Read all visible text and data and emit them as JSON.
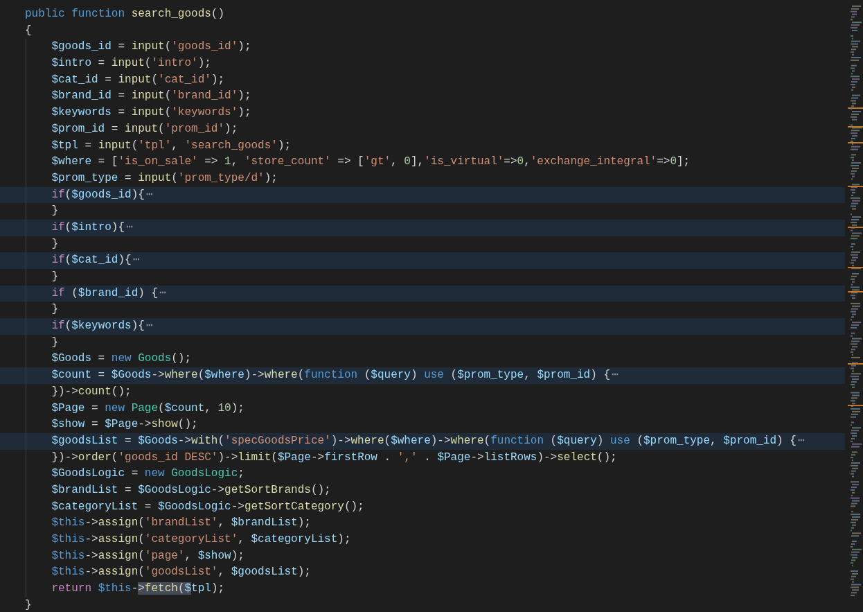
{
  "editor": {
    "lines": [
      {
        "folded": false,
        "tokens": [
          {
            "kind": "kw",
            "text": "public "
          },
          {
            "kind": "kw",
            "text": "function "
          },
          {
            "kind": "fn",
            "text": "search_goods"
          },
          {
            "kind": "p",
            "text": "()"
          }
        ]
      },
      {
        "folded": false,
        "tokens": [
          {
            "kind": "p",
            "text": "{"
          }
        ]
      },
      {
        "folded": false,
        "tokens": [
          {
            "kind": "var",
            "text": "    $goods_id"
          },
          {
            "kind": "p",
            "text": " = "
          },
          {
            "kind": "fn",
            "text": "input"
          },
          {
            "kind": "p",
            "text": "("
          },
          {
            "kind": "str",
            "text": "'goods_id'"
          },
          {
            "kind": "p",
            "text": ");"
          }
        ]
      },
      {
        "folded": false,
        "tokens": [
          {
            "kind": "var",
            "text": "    $intro"
          },
          {
            "kind": "p",
            "text": " = "
          },
          {
            "kind": "fn",
            "text": "input"
          },
          {
            "kind": "p",
            "text": "("
          },
          {
            "kind": "str",
            "text": "'intro'"
          },
          {
            "kind": "p",
            "text": ");"
          }
        ]
      },
      {
        "folded": false,
        "tokens": [
          {
            "kind": "var",
            "text": "    $cat_id"
          },
          {
            "kind": "p",
            "text": " = "
          },
          {
            "kind": "fn",
            "text": "input"
          },
          {
            "kind": "p",
            "text": "("
          },
          {
            "kind": "str",
            "text": "'cat_id'"
          },
          {
            "kind": "p",
            "text": ");"
          }
        ]
      },
      {
        "folded": false,
        "tokens": [
          {
            "kind": "var",
            "text": "    $brand_id"
          },
          {
            "kind": "p",
            "text": " = "
          },
          {
            "kind": "fn",
            "text": "input"
          },
          {
            "kind": "p",
            "text": "("
          },
          {
            "kind": "str",
            "text": "'brand_id'"
          },
          {
            "kind": "p",
            "text": ");"
          }
        ]
      },
      {
        "folded": false,
        "tokens": [
          {
            "kind": "var",
            "text": "    $keywords"
          },
          {
            "kind": "p",
            "text": " = "
          },
          {
            "kind": "fn",
            "text": "input"
          },
          {
            "kind": "p",
            "text": "("
          },
          {
            "kind": "str",
            "text": "'keywords'"
          },
          {
            "kind": "p",
            "text": ");"
          }
        ]
      },
      {
        "folded": false,
        "tokens": [
          {
            "kind": "var",
            "text": "    $prom_id"
          },
          {
            "kind": "p",
            "text": " = "
          },
          {
            "kind": "fn",
            "text": "input"
          },
          {
            "kind": "p",
            "text": "("
          },
          {
            "kind": "str",
            "text": "'prom_id'"
          },
          {
            "kind": "p",
            "text": ");"
          }
        ]
      },
      {
        "folded": false,
        "tokens": [
          {
            "kind": "var",
            "text": "    $tpl"
          },
          {
            "kind": "p",
            "text": " = "
          },
          {
            "kind": "fn",
            "text": "input"
          },
          {
            "kind": "p",
            "text": "("
          },
          {
            "kind": "str",
            "text": "'tpl'"
          },
          {
            "kind": "p",
            "text": ", "
          },
          {
            "kind": "str",
            "text": "'search_goods'"
          },
          {
            "kind": "p",
            "text": ");"
          }
        ]
      },
      {
        "folded": false,
        "tokens": [
          {
            "kind": "var",
            "text": "    $where"
          },
          {
            "kind": "p",
            "text": " = ["
          },
          {
            "kind": "str",
            "text": "'is_on_sale'"
          },
          {
            "kind": "p",
            "text": " => "
          },
          {
            "kind": "num",
            "text": "1"
          },
          {
            "kind": "p",
            "text": ", "
          },
          {
            "kind": "str",
            "text": "'store_count'"
          },
          {
            "kind": "p",
            "text": " => ["
          },
          {
            "kind": "str",
            "text": "'gt'"
          },
          {
            "kind": "p",
            "text": ", "
          },
          {
            "kind": "num",
            "text": "0"
          },
          {
            "kind": "p",
            "text": "],"
          },
          {
            "kind": "str",
            "text": "'is_virtual'"
          },
          {
            "kind": "p",
            "text": "=>"
          },
          {
            "kind": "num",
            "text": "0"
          },
          {
            "kind": "p",
            "text": ","
          },
          {
            "kind": "str",
            "text": "'exchange_integral'"
          },
          {
            "kind": "p",
            "text": "=>"
          },
          {
            "kind": "num",
            "text": "0"
          },
          {
            "kind": "p",
            "text": "];"
          }
        ]
      },
      {
        "folded": false,
        "tokens": [
          {
            "kind": "var",
            "text": "    $prom_type"
          },
          {
            "kind": "p",
            "text": " = "
          },
          {
            "kind": "fn",
            "text": "input"
          },
          {
            "kind": "p",
            "text": "("
          },
          {
            "kind": "str",
            "text": "'prom_type/d'"
          },
          {
            "kind": "p",
            "text": ");"
          }
        ]
      },
      {
        "folded": true,
        "fold_text": "⋯",
        "tokens": [
          {
            "kind": "ctrl",
            "text": "    if"
          },
          {
            "kind": "p",
            "text": "("
          },
          {
            "kind": "var",
            "text": "$goods_id"
          },
          {
            "kind": "p",
            "text": "){"
          }
        ]
      },
      {
        "folded": false,
        "tokens": [
          {
            "kind": "p",
            "text": "    }"
          }
        ]
      },
      {
        "folded": true,
        "fold_text": "⋯",
        "tokens": [
          {
            "kind": "ctrl",
            "text": "    if"
          },
          {
            "kind": "p",
            "text": "("
          },
          {
            "kind": "var",
            "text": "$intro"
          },
          {
            "kind": "p",
            "text": "){"
          }
        ]
      },
      {
        "folded": false,
        "tokens": [
          {
            "kind": "p",
            "text": "    }"
          }
        ]
      },
      {
        "folded": true,
        "fold_text": "⋯",
        "tokens": [
          {
            "kind": "ctrl",
            "text": "    if"
          },
          {
            "kind": "p",
            "text": "("
          },
          {
            "kind": "var",
            "text": "$cat_id"
          },
          {
            "kind": "p",
            "text": "){"
          }
        ]
      },
      {
        "folded": false,
        "tokens": [
          {
            "kind": "p",
            "text": "    }"
          }
        ]
      },
      {
        "folded": true,
        "fold_text": "⋯",
        "tokens": [
          {
            "kind": "ctrl",
            "text": "    if"
          },
          {
            "kind": "p",
            "text": " ("
          },
          {
            "kind": "var",
            "text": "$brand_id"
          },
          {
            "kind": "p",
            "text": ") {"
          }
        ]
      },
      {
        "folded": false,
        "tokens": [
          {
            "kind": "p",
            "text": "    }"
          }
        ]
      },
      {
        "folded": true,
        "fold_text": "⋯",
        "tokens": [
          {
            "kind": "ctrl",
            "text": "    if"
          },
          {
            "kind": "p",
            "text": "("
          },
          {
            "kind": "var",
            "text": "$keywords"
          },
          {
            "kind": "p",
            "text": "){"
          }
        ]
      },
      {
        "folded": false,
        "tokens": [
          {
            "kind": "p",
            "text": "    }"
          }
        ]
      },
      {
        "folded": false,
        "tokens": [
          {
            "kind": "var",
            "text": "    $Goods"
          },
          {
            "kind": "p",
            "text": " = "
          },
          {
            "kind": "kw",
            "text": "new "
          },
          {
            "kind": "cls",
            "text": "Goods"
          },
          {
            "kind": "p",
            "text": "();"
          }
        ]
      },
      {
        "folded": true,
        "fold_text": "⋯",
        "tokens": [
          {
            "kind": "var",
            "text": "    $count"
          },
          {
            "kind": "p",
            "text": " = "
          },
          {
            "kind": "var",
            "text": "$Goods"
          },
          {
            "kind": "p",
            "text": "->"
          },
          {
            "kind": "fn",
            "text": "where"
          },
          {
            "kind": "p",
            "text": "("
          },
          {
            "kind": "var",
            "text": "$where"
          },
          {
            "kind": "p",
            "text": ")->"
          },
          {
            "kind": "fn",
            "text": "where"
          },
          {
            "kind": "p",
            "text": "("
          },
          {
            "kind": "kw",
            "text": "function"
          },
          {
            "kind": "p",
            "text": " ("
          },
          {
            "kind": "var",
            "text": "$query"
          },
          {
            "kind": "p",
            "text": ") "
          },
          {
            "kind": "kw",
            "text": "use"
          },
          {
            "kind": "p",
            "text": " ("
          },
          {
            "kind": "var",
            "text": "$prom_type"
          },
          {
            "kind": "p",
            "text": ", "
          },
          {
            "kind": "var",
            "text": "$prom_id"
          },
          {
            "kind": "p",
            "text": ") {"
          }
        ]
      },
      {
        "folded": false,
        "tokens": [
          {
            "kind": "p",
            "text": "    })->"
          },
          {
            "kind": "fn",
            "text": "count"
          },
          {
            "kind": "p",
            "text": "();"
          }
        ]
      },
      {
        "folded": false,
        "tokens": [
          {
            "kind": "var",
            "text": "    $Page"
          },
          {
            "kind": "p",
            "text": " = "
          },
          {
            "kind": "kw",
            "text": "new "
          },
          {
            "kind": "cls",
            "text": "Page"
          },
          {
            "kind": "p",
            "text": "("
          },
          {
            "kind": "var",
            "text": "$count"
          },
          {
            "kind": "p",
            "text": ", "
          },
          {
            "kind": "num",
            "text": "10"
          },
          {
            "kind": "p",
            "text": ");"
          }
        ]
      },
      {
        "folded": false,
        "tokens": [
          {
            "kind": "var",
            "text": "    $show"
          },
          {
            "kind": "p",
            "text": " = "
          },
          {
            "kind": "var",
            "text": "$Page"
          },
          {
            "kind": "p",
            "text": "->"
          },
          {
            "kind": "fn",
            "text": "show"
          },
          {
            "kind": "p",
            "text": "();"
          }
        ]
      },
      {
        "folded": true,
        "fold_text": "⋯",
        "tokens": [
          {
            "kind": "var",
            "text": "    $goodsList"
          },
          {
            "kind": "p",
            "text": " = "
          },
          {
            "kind": "var",
            "text": "$Goods"
          },
          {
            "kind": "p",
            "text": "->"
          },
          {
            "kind": "fn",
            "text": "with"
          },
          {
            "kind": "p",
            "text": "("
          },
          {
            "kind": "str",
            "text": "'specGoodsPrice'"
          },
          {
            "kind": "p",
            "text": ")->"
          },
          {
            "kind": "fn",
            "text": "where"
          },
          {
            "kind": "p",
            "text": "("
          },
          {
            "kind": "var",
            "text": "$where"
          },
          {
            "kind": "p",
            "text": ")->"
          },
          {
            "kind": "fn",
            "text": "where"
          },
          {
            "kind": "p",
            "text": "("
          },
          {
            "kind": "kw",
            "text": "function"
          },
          {
            "kind": "p",
            "text": " ("
          },
          {
            "kind": "var",
            "text": "$query"
          },
          {
            "kind": "p",
            "text": ") "
          },
          {
            "kind": "kw",
            "text": "use"
          },
          {
            "kind": "p",
            "text": " ("
          },
          {
            "kind": "var",
            "text": "$prom_type"
          },
          {
            "kind": "p",
            "text": ", "
          },
          {
            "kind": "var",
            "text": "$prom_id"
          },
          {
            "kind": "p",
            "text": ") {"
          }
        ]
      },
      {
        "folded": false,
        "tokens": [
          {
            "kind": "p",
            "text": "    })->"
          },
          {
            "kind": "fn",
            "text": "order"
          },
          {
            "kind": "p",
            "text": "("
          },
          {
            "kind": "str",
            "text": "'goods_id DESC'"
          },
          {
            "kind": "p",
            "text": ")->"
          },
          {
            "kind": "fn",
            "text": "limit"
          },
          {
            "kind": "p",
            "text": "("
          },
          {
            "kind": "var",
            "text": "$Page"
          },
          {
            "kind": "p",
            "text": "->"
          },
          {
            "kind": "var",
            "text": "firstRow"
          },
          {
            "kind": "p",
            "text": " . "
          },
          {
            "kind": "str",
            "text": "','"
          },
          {
            "kind": "p",
            "text": " . "
          },
          {
            "kind": "var",
            "text": "$Page"
          },
          {
            "kind": "p",
            "text": "->"
          },
          {
            "kind": "var",
            "text": "listRows"
          },
          {
            "kind": "p",
            "text": ")->"
          },
          {
            "kind": "fn",
            "text": "select"
          },
          {
            "kind": "p",
            "text": "();"
          }
        ]
      },
      {
        "folded": false,
        "tokens": [
          {
            "kind": "var",
            "text": "    $GoodsLogic"
          },
          {
            "kind": "p",
            "text": " = "
          },
          {
            "kind": "kw",
            "text": "new "
          },
          {
            "kind": "cls",
            "text": "GoodsLogic"
          },
          {
            "kind": "p",
            "text": ";"
          }
        ]
      },
      {
        "folded": false,
        "tokens": [
          {
            "kind": "var",
            "text": "    $brandList"
          },
          {
            "kind": "p",
            "text": " = "
          },
          {
            "kind": "var",
            "text": "$GoodsLogic"
          },
          {
            "kind": "p",
            "text": "->"
          },
          {
            "kind": "fn",
            "text": "getSortBrands"
          },
          {
            "kind": "p",
            "text": "();"
          }
        ]
      },
      {
        "folded": false,
        "tokens": [
          {
            "kind": "var",
            "text": "    $categoryList"
          },
          {
            "kind": "p",
            "text": " = "
          },
          {
            "kind": "var",
            "text": "$GoodsLogic"
          },
          {
            "kind": "p",
            "text": "->"
          },
          {
            "kind": "fn",
            "text": "getSortCategory"
          },
          {
            "kind": "p",
            "text": "();"
          }
        ]
      },
      {
        "folded": false,
        "tokens": [
          {
            "kind": "kw",
            "text": "    $this"
          },
          {
            "kind": "p",
            "text": "->"
          },
          {
            "kind": "fn",
            "text": "assign"
          },
          {
            "kind": "p",
            "text": "("
          },
          {
            "kind": "str",
            "text": "'brandList'"
          },
          {
            "kind": "p",
            "text": ", "
          },
          {
            "kind": "var",
            "text": "$brandList"
          },
          {
            "kind": "p",
            "text": ");"
          }
        ]
      },
      {
        "folded": false,
        "tokens": [
          {
            "kind": "kw",
            "text": "    $this"
          },
          {
            "kind": "p",
            "text": "->"
          },
          {
            "kind": "fn",
            "text": "assign"
          },
          {
            "kind": "p",
            "text": "("
          },
          {
            "kind": "str",
            "text": "'categoryList'"
          },
          {
            "kind": "p",
            "text": ", "
          },
          {
            "kind": "var",
            "text": "$categoryList"
          },
          {
            "kind": "p",
            "text": ");"
          }
        ]
      },
      {
        "folded": false,
        "tokens": [
          {
            "kind": "kw",
            "text": "    $this"
          },
          {
            "kind": "p",
            "text": "->"
          },
          {
            "kind": "fn",
            "text": "assign"
          },
          {
            "kind": "p",
            "text": "("
          },
          {
            "kind": "str",
            "text": "'page'"
          },
          {
            "kind": "p",
            "text": ", "
          },
          {
            "kind": "var",
            "text": "$show"
          },
          {
            "kind": "p",
            "text": ");"
          }
        ]
      },
      {
        "folded": false,
        "tokens": [
          {
            "kind": "kw",
            "text": "    $this"
          },
          {
            "kind": "p",
            "text": "->"
          },
          {
            "kind": "fn",
            "text": "assign"
          },
          {
            "kind": "p",
            "text": "("
          },
          {
            "kind": "str",
            "text": "'goodsList'"
          },
          {
            "kind": "p",
            "text": ", "
          },
          {
            "kind": "var",
            "text": "$goodsList"
          },
          {
            "kind": "p",
            "text": ");"
          }
        ]
      },
      {
        "folded": false,
        "tokens": [
          {
            "kind": "ctrl",
            "text": "    return "
          },
          {
            "kind": "kw",
            "text": "$this"
          },
          {
            "kind": "p",
            "text": "-"
          },
          {
            "kind": "sel",
            "tokens": [
              {
                "kind": "p",
                "text": ">"
              },
              {
                "kind": "fn",
                "text": "fetch"
              },
              {
                "kind": "p",
                "text": "("
              },
              {
                "kind": "var",
                "text": "$"
              }
            ]
          },
          {
            "kind": "var",
            "text": "tpl"
          },
          {
            "kind": "p",
            "text": ");"
          }
        ]
      },
      {
        "folded": false,
        "tokens": [
          {
            "kind": "p",
            "text": "}"
          }
        ]
      }
    ]
  }
}
